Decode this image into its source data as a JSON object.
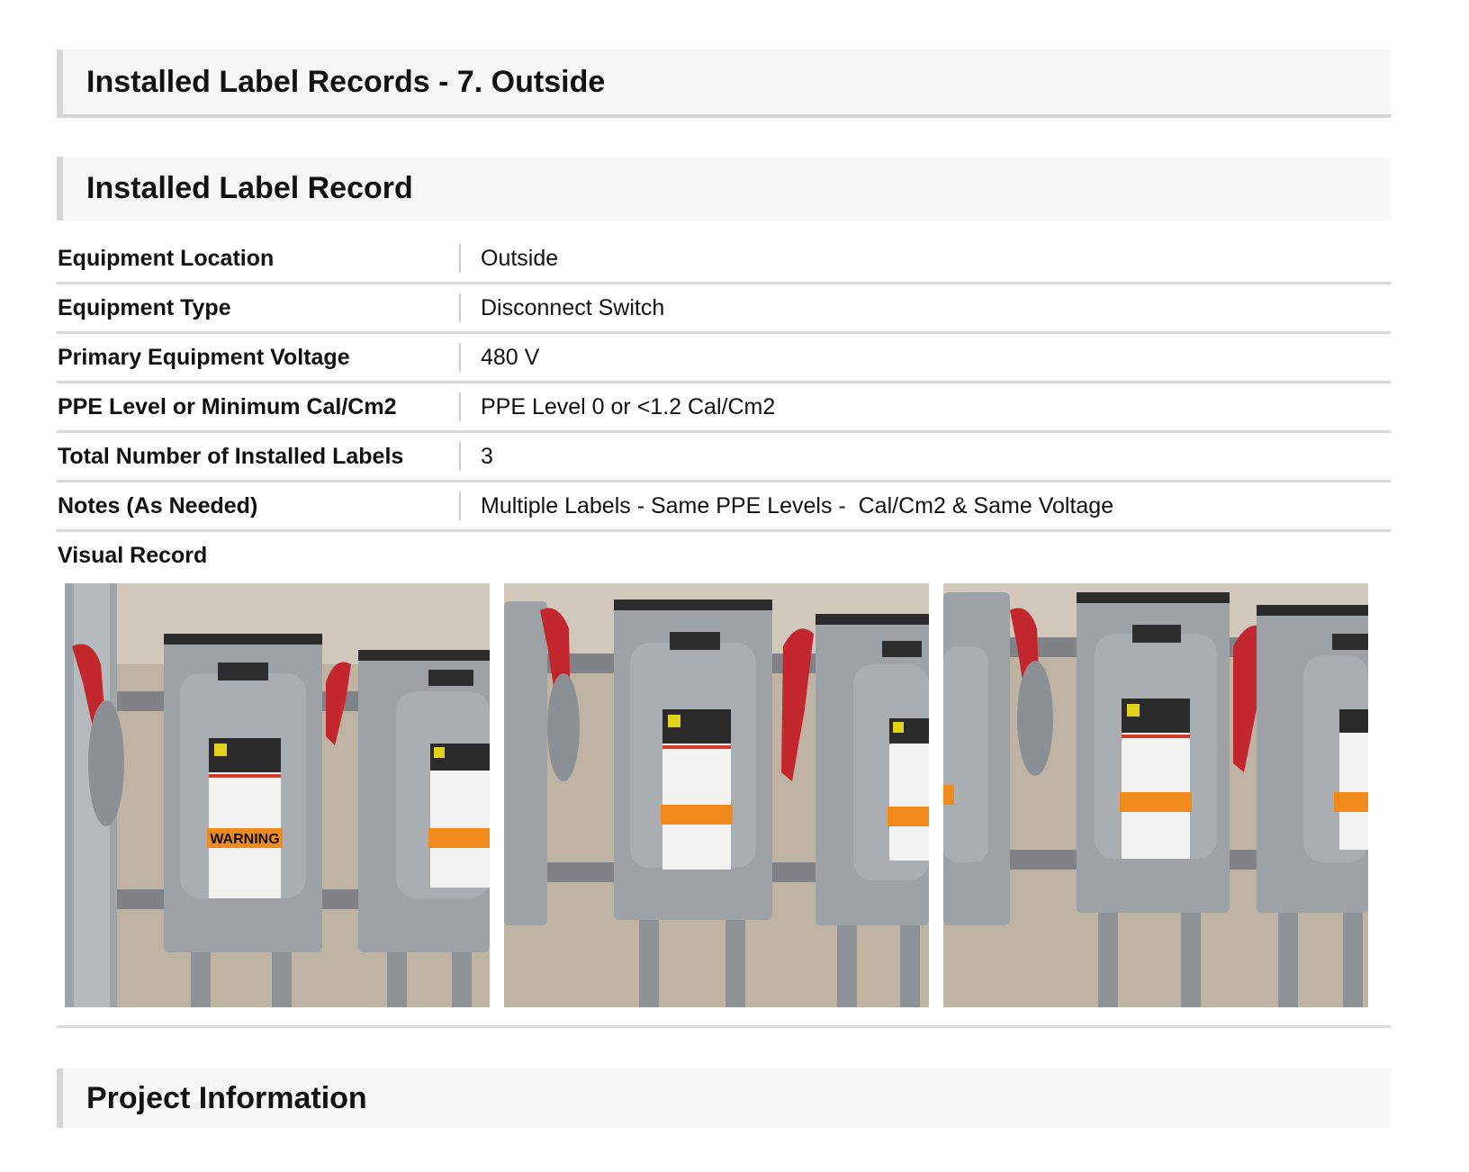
{
  "page": {
    "records_title": "Installed Label Records - 7. Outside",
    "record_title": "Installed Label Record",
    "project_title": "Project Information"
  },
  "record": {
    "rows": [
      {
        "label": "Equipment Location",
        "value": "Outside"
      },
      {
        "label": "Equipment Type",
        "value": "Disconnect Switch"
      },
      {
        "label": "Primary Equipment Voltage",
        "value": "480 V"
      },
      {
        "label": "PPE Level or Minimum Cal/Cm2",
        "value": "PPE Level 0 or <1.2 Cal/Cm2"
      },
      {
        "label": "Total Number of Installed Labels",
        "value": "3"
      },
      {
        "label": "Notes (As Needed)",
        "value": "Multiple Labels - Same PPE Levels -  Cal/Cm2 & Same Voltage"
      }
    ],
    "visual_label": "Visual Record"
  },
  "photos": {
    "warning_text": "WARNING"
  }
}
